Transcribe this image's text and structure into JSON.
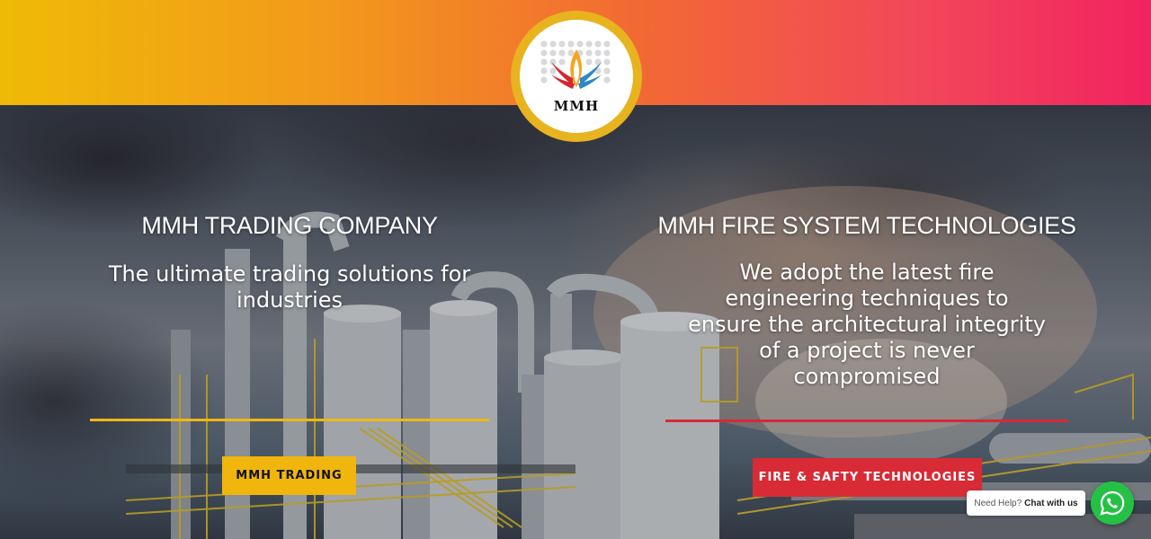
{
  "logo": {
    "text": "MMH",
    "name": "mmh-logo"
  },
  "left": {
    "title": "MMH TRADING COMPANY",
    "description": "The ultimate trading solutions for industries",
    "button": "MMH TRADING"
  },
  "right": {
    "title": "MMH FIRE SYSTEM TECHNOLOGIES",
    "description": "We adopt the latest fire engineering techniques to ensure the architectural integrity of a project is never compromised",
    "button": "FIRE & SAFTY TECHNOLOGIES"
  },
  "chat": {
    "prefix": "Need Help?",
    "cta": "Chat with us",
    "icon": "whatsapp-icon"
  },
  "colors": {
    "yellow": "#f0b60d",
    "red": "#d82b36",
    "whatsapp": "#25c145"
  }
}
